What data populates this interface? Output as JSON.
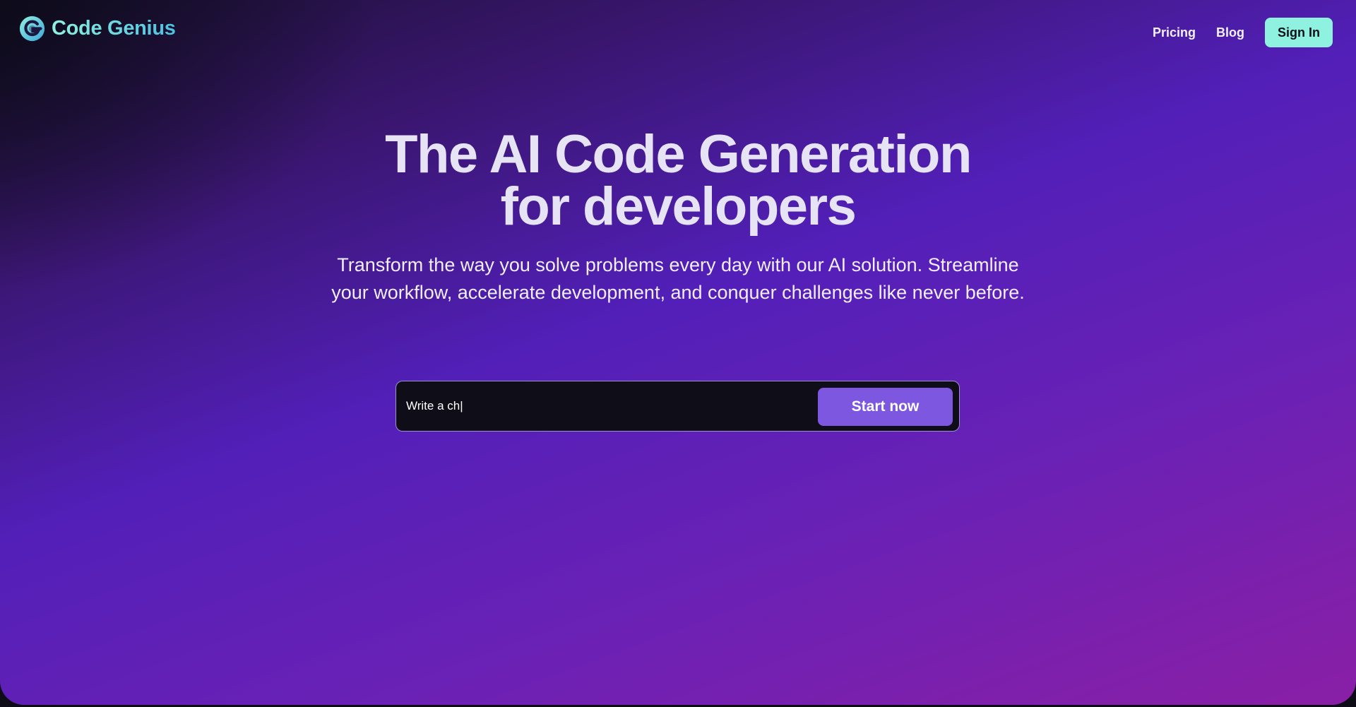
{
  "header": {
    "brand_name": "Code Genius",
    "nav": [
      {
        "label": "Pricing"
      },
      {
        "label": "Blog"
      }
    ],
    "signin_label": "Sign In"
  },
  "hero": {
    "title_line1": "The AI Code Generation",
    "title_line2": "for developers",
    "subtitle": "Transform the way you solve problems every day with our AI solution. Streamline your workflow, accelerate development, and conquer challenges like never before."
  },
  "prompt": {
    "value": "Write a ch|",
    "button_label": "Start now"
  },
  "colors": {
    "accent_mint": "#8ff2e0",
    "button_purple": "#7d57e0",
    "input_bg": "#0f0d18"
  },
  "icons": {
    "logo": "code-genius-logo-icon"
  }
}
